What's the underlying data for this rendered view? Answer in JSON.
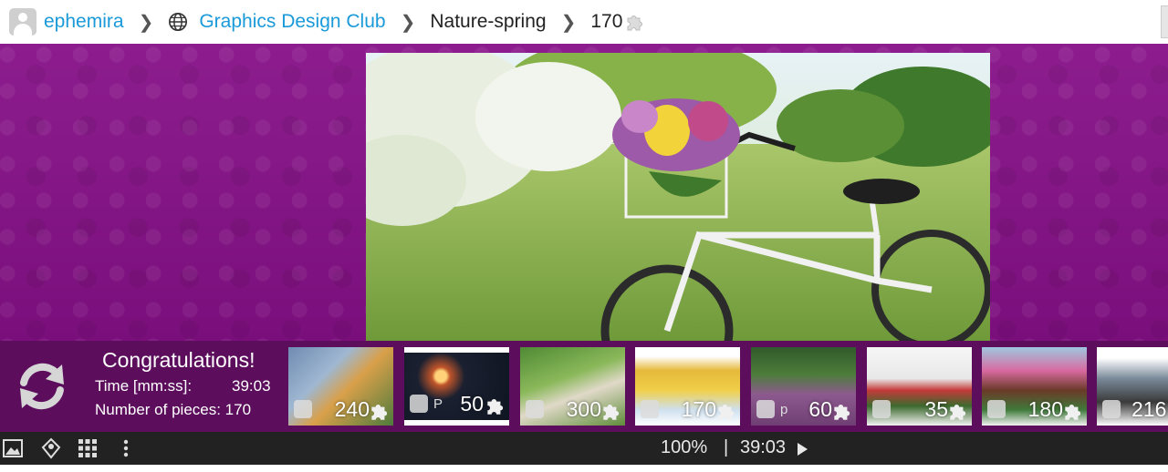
{
  "breadcrumb": {
    "user": "ephemira",
    "group": "Graphics Design Club",
    "category": "Nature-spring",
    "pieces": "170"
  },
  "result": {
    "title": "Congratulations!",
    "time_label": "Time [mm:ss]:",
    "time_value": "39:03",
    "pieces_label": "Number of pieces: 170"
  },
  "thumbnails": [
    {
      "count": "240"
    },
    {
      "count": "50",
      "prefix": "P"
    },
    {
      "count": "300"
    },
    {
      "count": "170"
    },
    {
      "count": "60",
      "prefix": "p"
    },
    {
      "count": "35"
    },
    {
      "count": "180"
    },
    {
      "count": "216"
    }
  ],
  "toolbar": {
    "zoom": "100%",
    "divider": "|",
    "timer": "39:03"
  },
  "icons": {
    "user": "avatar-icon",
    "group": "globe-icon",
    "pieces": "puzzle-piece-icon",
    "restart": "refresh-icon",
    "preview": "image-icon",
    "edges": "edge-pieces-icon",
    "grid": "grid-icon",
    "menu": "more-vertical-icon",
    "play": "play-icon"
  },
  "colors": {
    "link": "#1a9ad9",
    "background": "#7f1380",
    "strip": "#5c0e5d",
    "toolbar": "#222222"
  }
}
